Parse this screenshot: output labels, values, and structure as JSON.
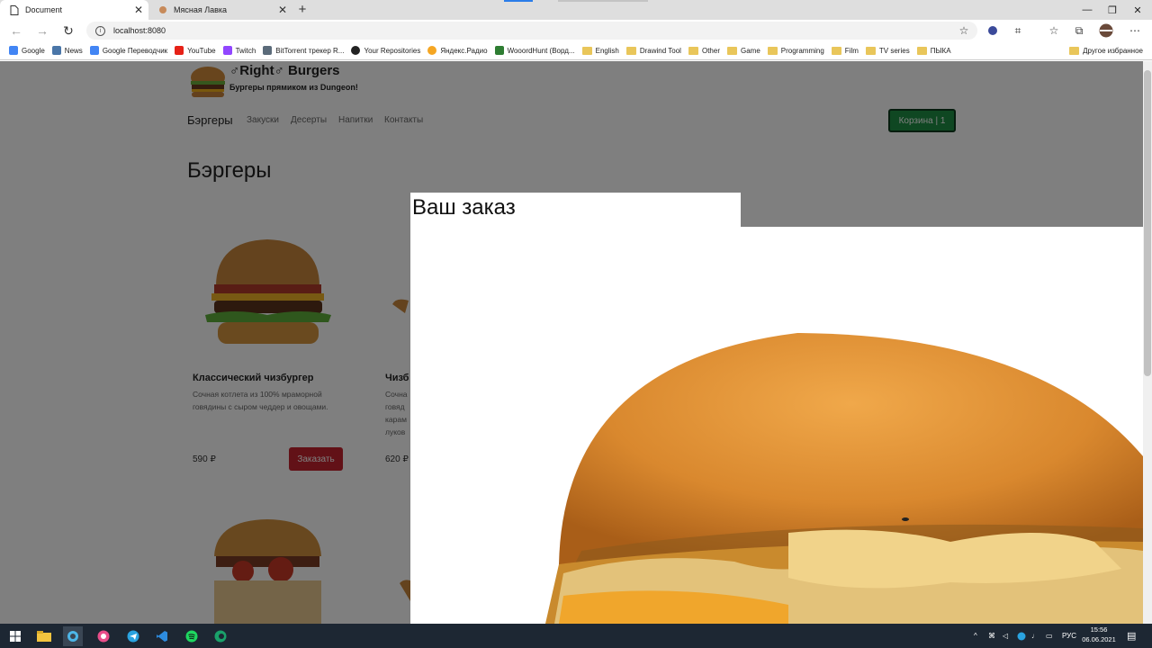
{
  "browser": {
    "tabs": [
      {
        "title": "Document",
        "active": true
      },
      {
        "title": "Мясная Лавка",
        "active": false
      }
    ],
    "url": "localhost:8080",
    "bookmarks": [
      "Google",
      "News",
      "Google Переводчик",
      "YouTube",
      "Twitch",
      "BitTorrent трекер R...",
      "Your Repositories",
      "Яндекс.Радио",
      "WooordHunt (Ворд...",
      "English",
      "Drawind Tool",
      "Other",
      "Game",
      "Programming",
      "Film",
      "TV series",
      "ПЫКА"
    ],
    "other_bookmarks": "Другое избранное"
  },
  "site": {
    "brand": "♂Right♂ Burgers",
    "tagline": "Бургеры прямиком из Dungeon!",
    "nav": [
      "Бэргеры",
      "Закуски",
      "Десерты",
      "Напитки",
      "Контакты"
    ],
    "cart_label": "Корзина | 1",
    "section_title": "Бэргеры",
    "products": [
      {
        "title": "Классический чизбургер",
        "desc_line1": "Сочная котлета из 100% мраморной",
        "desc_line2": "говядины с сыром чеддер и овощами.",
        "price": "590 ₽",
        "order_label": "Заказать"
      },
      {
        "title": "Чизб",
        "desc_line1": "Сочна",
        "desc_line2": "говяд",
        "desc_line3": "карам",
        "desc_line4": "луков",
        "price": "620 ₽"
      }
    ]
  },
  "modal": {
    "title": "Ваш заказ"
  },
  "taskbar": {
    "lang": "РУС",
    "time": "15:56",
    "date": "06.06.2021"
  },
  "colors": {
    "cart_green": "#1f8f44",
    "order_red": "#c5222e",
    "overlay": "rgba(0,0,0,0.5)",
    "taskbar": "#1d2733"
  }
}
